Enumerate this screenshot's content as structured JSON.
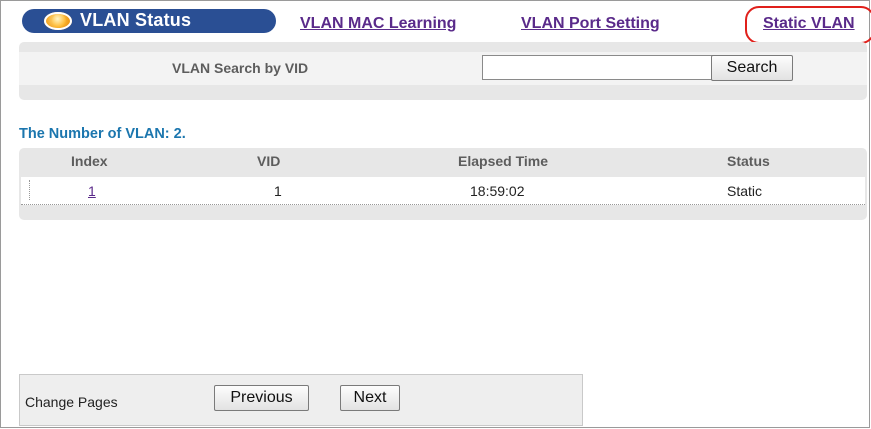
{
  "tabs": {
    "active": "VLAN Status",
    "mac_learning": "VLAN MAC Learning",
    "port_setting": "VLAN Port Setting",
    "static_vlan": "Static VLAN"
  },
  "search": {
    "label": "VLAN Search by VID",
    "value": "",
    "button": "Search"
  },
  "count_text": "The Number of VLAN: 2.",
  "table": {
    "headers": [
      "Index",
      "VID",
      "Elapsed Time",
      "Status"
    ],
    "rows": [
      {
        "index": "1",
        "vid": "1",
        "elapsed": "18:59:02",
        "status": "Static"
      }
    ]
  },
  "pager": {
    "label": "Change Pages",
    "previous": "Previous",
    "next": "Next"
  },
  "colors": {
    "active_tab_bg": "#2a4f94",
    "link": "#5a2a8a",
    "count_text": "#1b76ae",
    "highlight_ring": "#e0201b"
  }
}
